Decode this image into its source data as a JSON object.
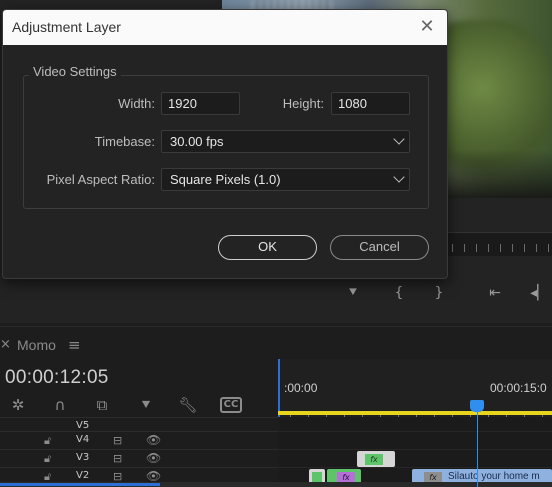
{
  "dialog": {
    "title": "Adjustment Layer",
    "group_label": "Video Settings",
    "width_label": "Width:",
    "width_value": "1920",
    "height_label": "Height:",
    "height_value": "1080",
    "timebase_label": "Timebase:",
    "timebase_value": "30.00 fps",
    "par_label": "Pixel Aspect Ratio:",
    "par_value": "Square Pixels (1.0)",
    "ok_label": "OK",
    "cancel_label": "Cancel"
  },
  "timeline": {
    "tab_label": "Momo",
    "timecode": "00:00:12:05",
    "ruler_start": ":00:00",
    "ruler_mid": "00:00:15:0",
    "tracks": [
      {
        "name": "V5"
      },
      {
        "name": "V4"
      },
      {
        "name": "V3"
      },
      {
        "name": "V2"
      }
    ],
    "clips": {
      "fx_badge": "fx",
      "v2_blue_label": "Silauto your home m"
    }
  },
  "colors": {
    "accent_blue": "#2f8ff0",
    "work_area_yellow": "#e8d51d",
    "clip_green": "#5ec46a",
    "clip_purple_fx": "#b56fd6",
    "clip_blue": "#8eb1e0"
  }
}
